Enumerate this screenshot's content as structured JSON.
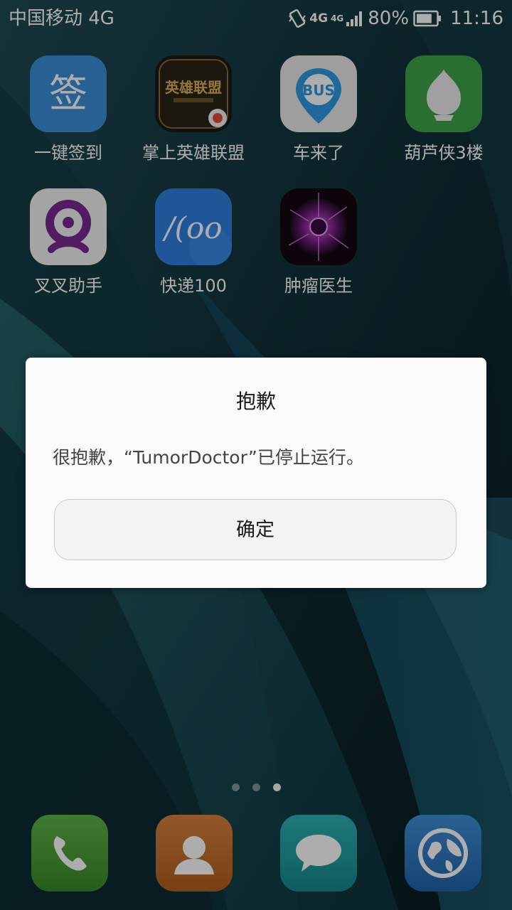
{
  "status_bar": {
    "carrier": "中国移动 4G",
    "network_primary": "4G",
    "network_secondary": "4G",
    "battery_percent": "80%",
    "battery_level": 0.8,
    "time": "11:16",
    "icons": [
      "vibrate-icon",
      "signal-icon",
      "battery-icon"
    ]
  },
  "home": {
    "apps": [
      {
        "label": "一键签到",
        "icon": "qiandao-app-icon",
        "glyph": "签",
        "color": "#3b8fd8"
      },
      {
        "label": "掌上英雄联盟",
        "icon": "lol-app-icon",
        "glyph": "英雄联盟",
        "color": "#1c1c1c"
      },
      {
        "label": "车来了",
        "icon": "bus-app-icon",
        "glyph": "BUS",
        "color": "#eaeaea"
      },
      {
        "label": "葫芦侠3楼",
        "icon": "gourd-app-icon",
        "color": "#3fa34a"
      },
      {
        "label": "叉叉助手",
        "icon": "chacha-app-icon",
        "color": "#f2f2f2"
      },
      {
        "label": "快递100",
        "icon": "kuaidi-app-icon",
        "glyph": "/(oo",
        "color": "#2e7fe0"
      },
      {
        "label": "肿瘤医生",
        "icon": "tumor-app-icon",
        "color": "#2a0d2a"
      }
    ],
    "page_count": 3,
    "active_page": 3,
    "dock": [
      {
        "icon": "phone-icon",
        "color": "#4a9b34"
      },
      {
        "icon": "contacts-icon",
        "color": "#c8702e"
      },
      {
        "icon": "messages-icon",
        "color": "#1f9fa0"
      },
      {
        "icon": "browser-icon",
        "color": "#2f7ec9"
      }
    ]
  },
  "dialog": {
    "title": "抱歉",
    "message": "很抱歉，“TumorDoctor”已停止运行。",
    "ok_label": "确定"
  },
  "colors": {
    "dialog_background": "#fafafa",
    "dim_overlay": "rgba(0,0,0,0.32)"
  }
}
